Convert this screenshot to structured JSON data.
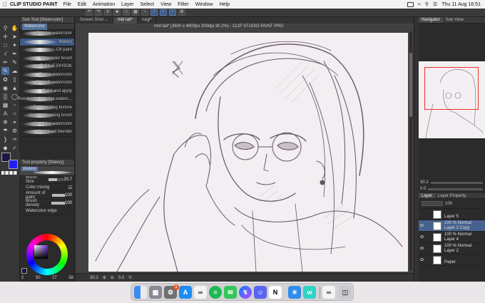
{
  "menubar": {
    "app_name": "CLIP STUDIO PAINT",
    "menus": [
      "File",
      "Edit",
      "Animation",
      "Layer",
      "Select",
      "View",
      "Filter",
      "Window",
      "Help"
    ],
    "datetime": "Thu 11 Aug  16:51"
  },
  "document": {
    "title": "mid tail* (3600 x 4800px 300dpi 30.2%) - CLIP STUDIO PAINT PRO",
    "tabs": [
      "Screen Shot ...",
      "mid tail*",
      "nagi*"
    ]
  },
  "subtool": {
    "header": "Sub Tool [Watercolor]",
    "tab": "Watercolor",
    "brushes": [
      {
        "name": "Opaque watercolor",
        "selected": false
      },
      {
        "name": "Watery",
        "selected": true
      },
      {
        "name": "Oil paint",
        "selected": false
      },
      {
        "name": "Watercolor brush",
        "selected": false
      },
      {
        "name": "rkTaBKuFJ0HSOK",
        "selected": false
      },
      {
        "name": "Dense watercolor",
        "selected": false
      },
      {
        "name": "Smooth watercolor",
        "selected": false
      },
      {
        "name": "Paint and apply",
        "selected": false
      },
      {
        "name": "Running color edge waterc...",
        "selected": false
      },
      {
        "name": "Emphasizing texture",
        "selected": false
      },
      {
        "name": "Uneven layering brush",
        "selected": false
      },
      {
        "name": "Soothing watercolor",
        "selected": false
      },
      {
        "name": "Wet bleed blender",
        "selected": false
      }
    ]
  },
  "toolprop": {
    "header": "Tool property [Watery]",
    "brush_name": "Watery",
    "rows": [
      {
        "label": "Brush Size",
        "value": "20.7",
        "fill": 0.55
      },
      {
        "label": "Color mixing",
        "value": "",
        "fill": 0
      },
      {
        "label": "Amount of paint",
        "value": "100",
        "fill": 1.0
      },
      {
        "label": "Brush density",
        "value": "100",
        "fill": 1.0
      },
      {
        "label": "Watercolor edge",
        "value": "",
        "fill": 0
      }
    ]
  },
  "colors": {
    "main": "#1e1640",
    "sub": "#1f1ff5",
    "hsv": [
      "2",
      "50",
      "27",
      "58"
    ]
  },
  "canvas_status": {
    "zoom": "30.2",
    "angle": "0.0"
  },
  "navigator": {
    "tabs": [
      "Navigator",
      "Sub View"
    ],
    "zoom": "30.2",
    "angle": "0.0"
  },
  "layers": {
    "tabs": [
      "Layer",
      "Layer Property"
    ],
    "opacity": "100",
    "items": [
      {
        "name": "Layer 5",
        "mode": "",
        "active": false
      },
      {
        "name": "Layer 2 Copy",
        "mode": "100 % Normal",
        "active": true
      },
      {
        "name": "Layer 4",
        "mode": "100 % Normal",
        "active": false
      },
      {
        "name": "Layer 2",
        "mode": "100 % Normal",
        "active": false
      },
      {
        "name": "Paper",
        "mode": "",
        "active": false
      }
    ]
  },
  "dock": {
    "apps": [
      "finder-icon",
      "launchpad-icon",
      "settings-icon",
      "app-store-icon",
      "clip-studio-icon",
      "spotify-icon",
      "messages-icon",
      "messenger-icon",
      "discord-icon",
      "notion-icon",
      "safari-icon",
      "webtoon-icon",
      "link-icon",
      "trash-icon"
    ],
    "settings_badge": "1"
  }
}
